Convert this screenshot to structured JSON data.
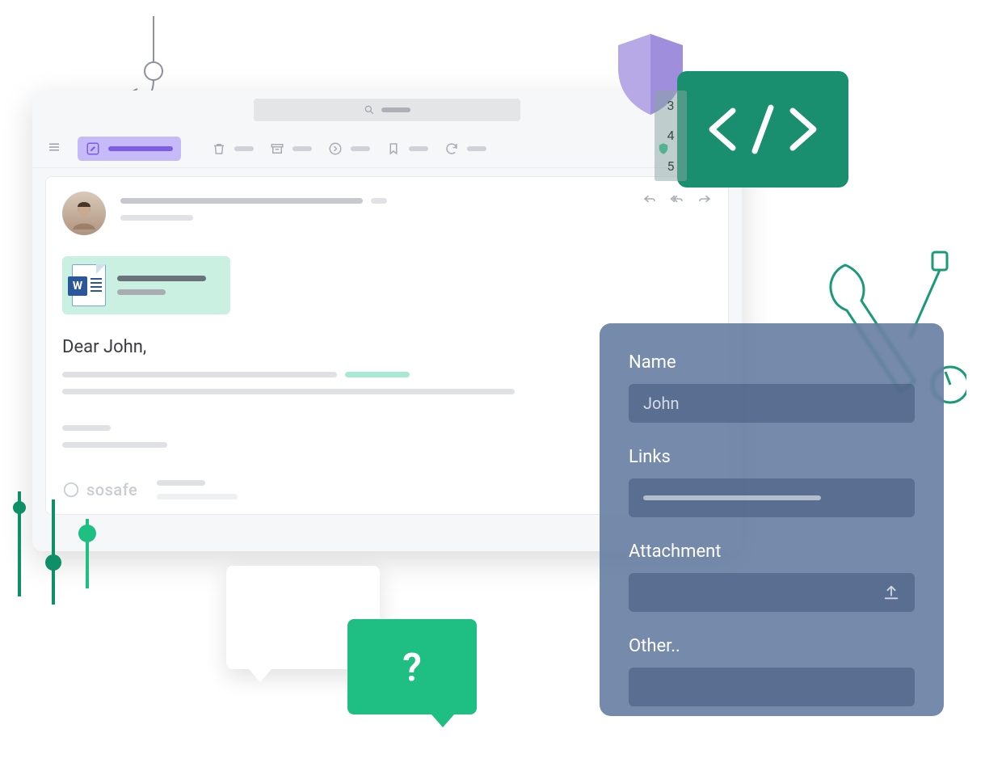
{
  "toolbar": {
    "action_labels": [
      "trash",
      "archive",
      "move",
      "bookmark",
      "refresh"
    ]
  },
  "email": {
    "greeting": "Dear John,",
    "attachment": {
      "badge": "W"
    },
    "brand": "sosafe"
  },
  "code_panel": {
    "line_numbers": [
      "3",
      "4",
      "5"
    ]
  },
  "form": {
    "fields": {
      "name": {
        "label": "Name",
        "value": "John"
      },
      "links": {
        "label": "Links"
      },
      "attachment": {
        "label": "Attachment"
      },
      "other": {
        "label": "Other.."
      }
    }
  },
  "chat": {
    "question_mark": "?"
  }
}
